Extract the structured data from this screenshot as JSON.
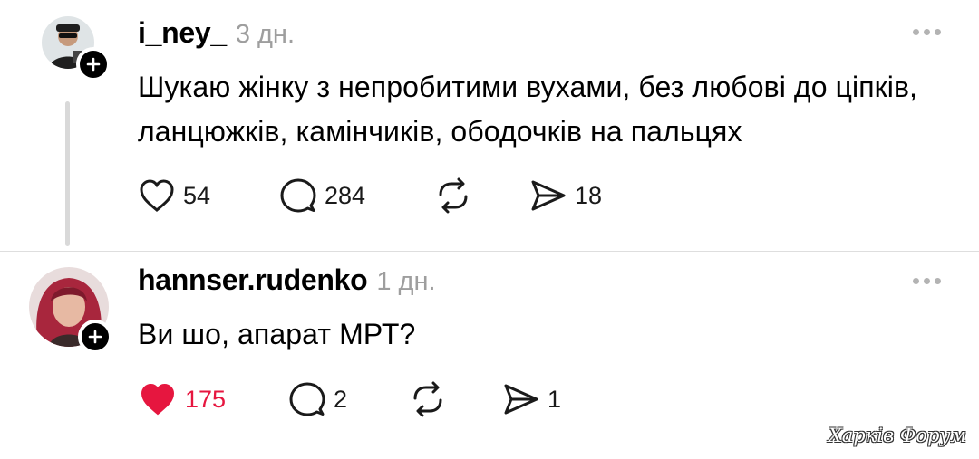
{
  "posts": [
    {
      "username": "i_ney_",
      "time": "3 дн.",
      "text": "Шукаю жінку з непробитими вухами, без любові до ціпків, ланцюжків, камінчиків, ободочків на пальцях",
      "likes": "54",
      "comments": "284",
      "shares": "18",
      "liked": false
    },
    {
      "username": "hannser.rudenko",
      "time": "1 дн.",
      "text": "Ви шо, апарат МРТ?",
      "likes": "175",
      "comments": "2",
      "shares": "1",
      "liked": true
    }
  ],
  "colors": {
    "like_active": "#e6163f",
    "muted": "#9e9e9e",
    "thread_line": "#d9d9d9"
  },
  "icons": [
    "heart-icon",
    "comment-icon",
    "repost-icon",
    "share-icon",
    "more-icon",
    "follow-plus-icon"
  ],
  "watermark": "Харків Форум"
}
